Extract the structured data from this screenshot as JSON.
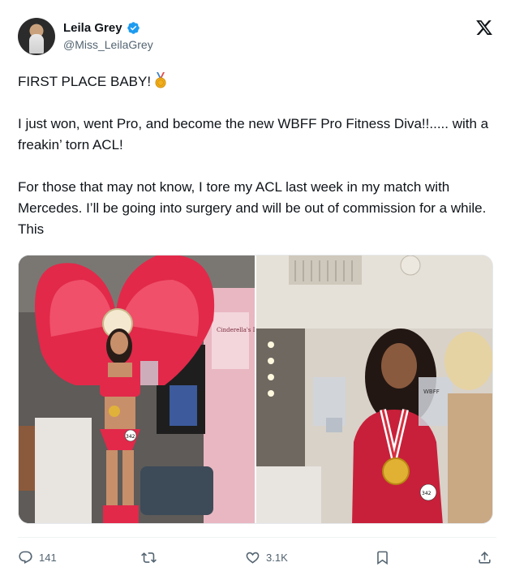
{
  "author": {
    "name": "Leila Grey",
    "handle": "@Miss_LeilaGrey",
    "verified": true
  },
  "platform_icon": "x-logo-icon",
  "tweet": {
    "paragraphs": [
      "FIRST PLACE BABY!",
      "I just won, went Pro, and become the new WBFF Pro Fitness Diva!!..... with a freakin’ torn ACL!",
      "For those that may not know, I tore my ACL last week in my match with Mercedes. I’ll be going into surgery and will be out of commission for a while. This"
    ],
    "emoji": "medal-icon"
  },
  "media": {
    "left_sign_text": "Cinderella's Dreams",
    "left_badge_number": "342",
    "right_badge_number": "342",
    "right_trophy_text": "WBFF"
  },
  "actions": {
    "replies": "141",
    "retweets": "",
    "likes": "3.1K"
  },
  "colors": {
    "text": "#0f1419",
    "secondary": "#536471",
    "verified": "#1d9bf0"
  }
}
